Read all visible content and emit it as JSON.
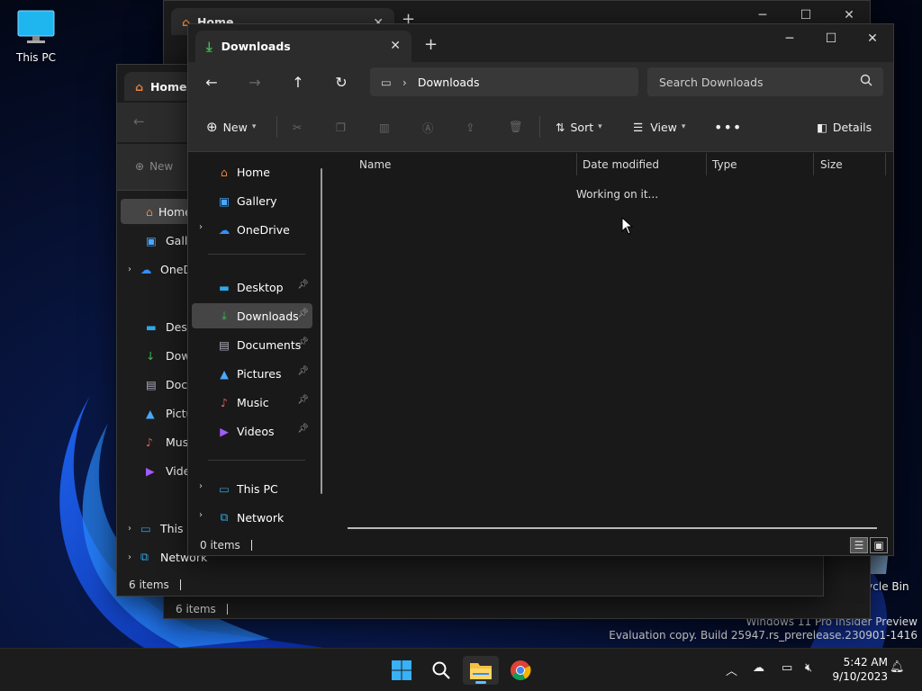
{
  "desktop": {
    "icons": [
      {
        "label": "This PC"
      },
      {
        "label": "Recycle Bin"
      }
    ],
    "watermark": {
      "line1": "Windows 11 Pro Insider Preview",
      "line2": "Evaluation copy. Build 25947.rs_prerelease.230901-1416"
    }
  },
  "back_window_top": {
    "tab_title": "Home",
    "status_items": "6 items"
  },
  "back_window_mid": {
    "tab_title": "Home",
    "new_label": "New",
    "sidebar": [
      "Home",
      "Gallery",
      "OneDrive",
      "Desktop",
      "Downloads",
      "Documents",
      "Pictures",
      "Music",
      "Videos",
      "This PC",
      "Network"
    ],
    "status_items": "6 items"
  },
  "main_window": {
    "tab_title": "Downloads",
    "address": {
      "location": "Downloads"
    },
    "search": {
      "placeholder": "Search Downloads"
    },
    "toolbar": {
      "new_label": "New",
      "sort_label": "Sort",
      "view_label": "View",
      "details_label": "Details"
    },
    "sidebar": {
      "items": [
        {
          "label": "Home"
        },
        {
          "label": "Gallery"
        },
        {
          "label": "OneDrive"
        },
        {
          "label": "Desktop"
        },
        {
          "label": "Downloads"
        },
        {
          "label": "Documents"
        },
        {
          "label": "Pictures"
        },
        {
          "label": "Music"
        },
        {
          "label": "Videos"
        },
        {
          "label": "This PC"
        },
        {
          "label": "Network"
        }
      ]
    },
    "columns": [
      "Name",
      "Date modified",
      "Type",
      "Size"
    ],
    "loading_text": "Working on it...",
    "status": {
      "items": "0 items"
    }
  },
  "taskbar": {
    "clock": {
      "time": "5:42 AM",
      "date": "9/10/2023"
    }
  },
  "colors": {
    "accent": "#5dc3f4",
    "downloads_green": "#3fb950",
    "home_orange": "#e8833a",
    "folder_yellow": "#f5c043"
  }
}
